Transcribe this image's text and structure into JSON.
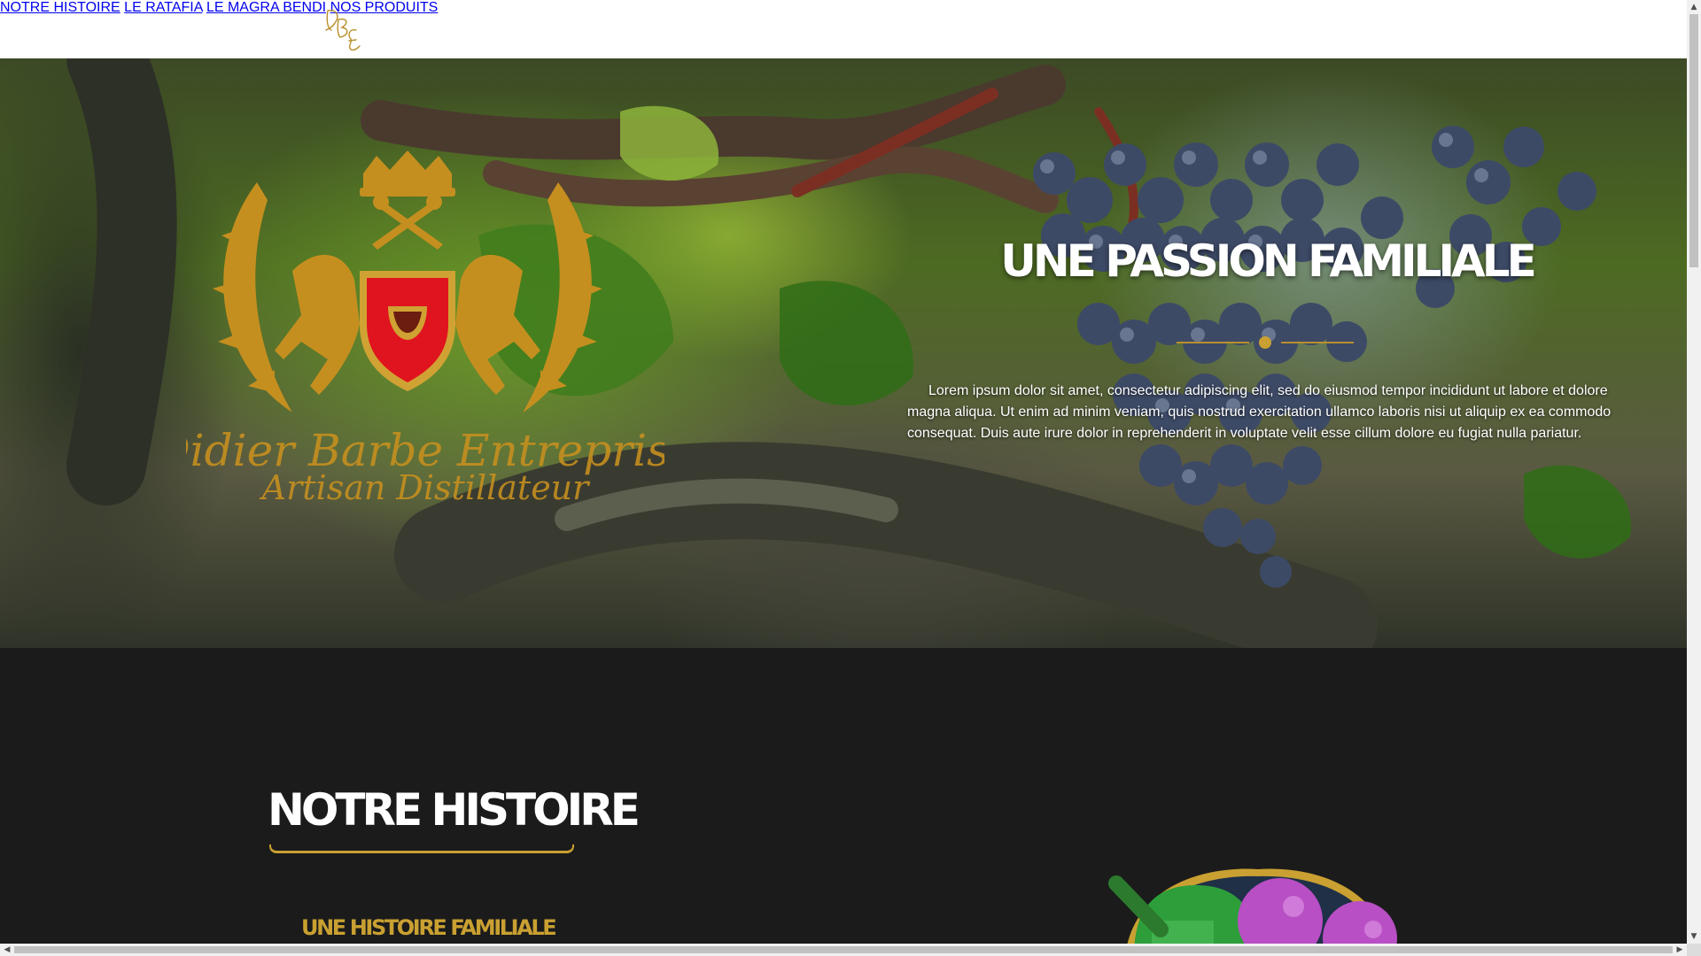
{
  "header": {
    "logo_icon": "dbe-monogram-logo",
    "nav": [
      {
        "label": "NOTRE HISTOIRE"
      },
      {
        "label": "LE RATAFIA"
      },
      {
        "label": "LE MAGRA BENDI"
      },
      {
        "label": "NOS PRODUITS"
      }
    ]
  },
  "hero": {
    "background": "grapevine-photo",
    "crest_icon": "coat-of-arms-crest",
    "crest_text_line1": "Didier Barbe Entreprise",
    "crest_text_line2": "Artisan Distillateur",
    "title": "UNE PASSION FAMILIALE",
    "body": "Lorem ipsum dolor sit amet, consectetur adipiscing elit, sed do eiusmod tempor incididunt ut labore et dolore magna aliqua. Ut enim ad minim veniam, quis nostrud exercitation ullamco laboris nisi ut aliquip ex ea commodo consequat. Duis aute irure dolor in reprehenderit in voluptate velit esse cillum dolore eu fugiat nulla pariatur."
  },
  "histoire": {
    "title": "NOTRE HISTOIRE",
    "subtitle": "UNE HISTOIRE FAMILIALE",
    "illustration": "fruit-bowl-illustration"
  },
  "colors": {
    "gold": "#c9a031",
    "nav_text": "#8a6b1e",
    "dark_section": "#1b1b1b",
    "crest_red": "#e0141e"
  },
  "scrollbar": {
    "up_arrow": "▲",
    "down_arrow": "▼",
    "left_arrow": "◀",
    "right_arrow": "▶"
  }
}
